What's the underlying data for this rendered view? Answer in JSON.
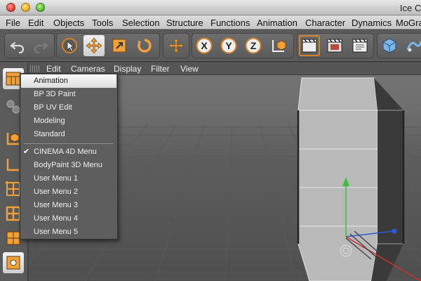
{
  "window": {
    "title": "Ice C"
  },
  "menubar": {
    "items": [
      "File",
      "Edit",
      "Objects",
      "Tools",
      "Selection",
      "Structure",
      "Functions",
      "Animation",
      "Character",
      "Dynamics",
      "MoGra"
    ]
  },
  "toolbar": {
    "icons": [
      "undo-icon",
      "redo-icon",
      "live-selection-icon",
      "move-icon",
      "scale-icon",
      "rotate-icon",
      "recent-tools-icon",
      "x-axis-icon",
      "y-axis-icon",
      "z-axis-icon",
      "coordinate-system-icon",
      "render-view-icon",
      "render-to-picture-viewer-icon",
      "render-settings-icon",
      "cube-icon",
      "bend-deformer-icon"
    ]
  },
  "viewport_menu": {
    "items": [
      "Edit",
      "Cameras",
      "Display",
      "Filter",
      "View"
    ]
  },
  "layout_popup": {
    "items": [
      {
        "label": "Animation",
        "selected": true,
        "checked": false
      },
      {
        "label": "BP 3D Paint",
        "selected": false,
        "checked": false
      },
      {
        "label": "BP UV Edit",
        "selected": false,
        "checked": false
      },
      {
        "label": "Modeling",
        "selected": false,
        "checked": false
      },
      {
        "label": "Standard",
        "selected": false,
        "checked": false
      },
      {
        "label": "CINEMA 4D Menu",
        "selected": false,
        "checked": true
      },
      {
        "label": "BodyPaint 3D Menu",
        "selected": false,
        "checked": false
      },
      {
        "label": "User Menu 1",
        "selected": false,
        "checked": false
      },
      {
        "label": "User Menu 2",
        "selected": false,
        "checked": false
      },
      {
        "label": "User Menu 3",
        "selected": false,
        "checked": false
      },
      {
        "label": "User Menu 4",
        "selected": false,
        "checked": false
      },
      {
        "label": "User Menu 5",
        "selected": false,
        "checked": false
      }
    ],
    "check_glyph": "✔"
  },
  "colors": {
    "accent": "#d2832b",
    "y_axis": "#3cbf3c",
    "x_axis": "#d03030",
    "z_axis": "#2a5bd8"
  }
}
